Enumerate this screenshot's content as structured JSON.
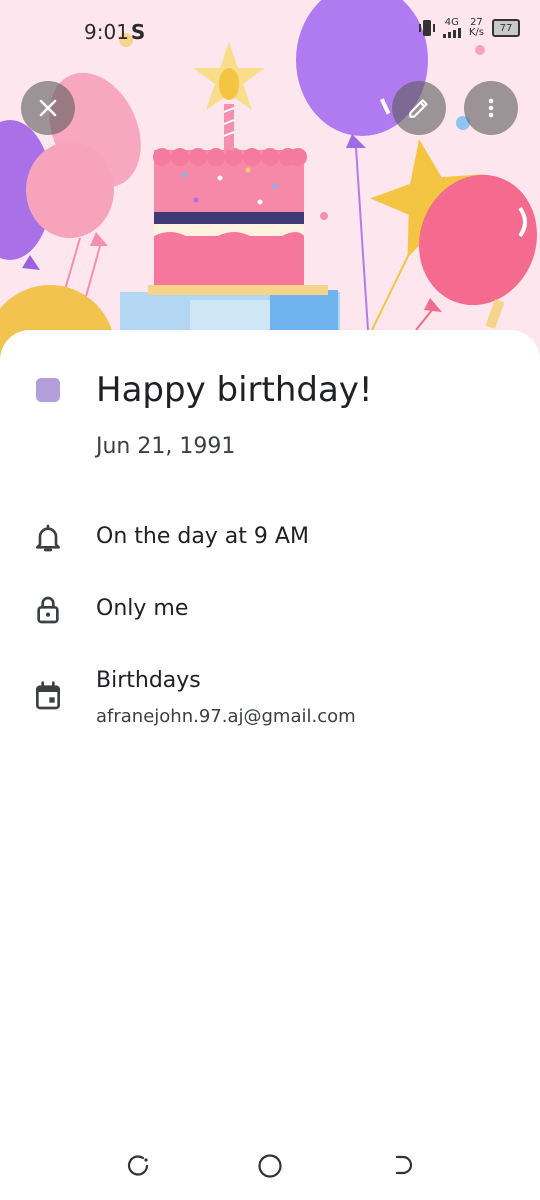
{
  "status_bar": {
    "time": "9:01",
    "carrier_glyph": "S",
    "network_type": "4G",
    "speed_value": "27",
    "speed_unit": "K/s",
    "battery": "77"
  },
  "header": {
    "close_icon": "close-icon",
    "edit_icon": "pencil-icon",
    "more_icon": "more-vert-icon"
  },
  "event": {
    "color": "#b39ddb",
    "title": "Happy birthday!",
    "date": "Jun 21, 1991"
  },
  "details": {
    "reminder": "On the day at 9 AM",
    "visibility": "Only me",
    "calendar_name": "Birthdays",
    "calendar_account": "afranejohn.97.aj@gmail.com"
  },
  "nav": {
    "recents_icon": "recents-icon",
    "home_icon": "home-icon",
    "back_icon": "back-icon"
  }
}
